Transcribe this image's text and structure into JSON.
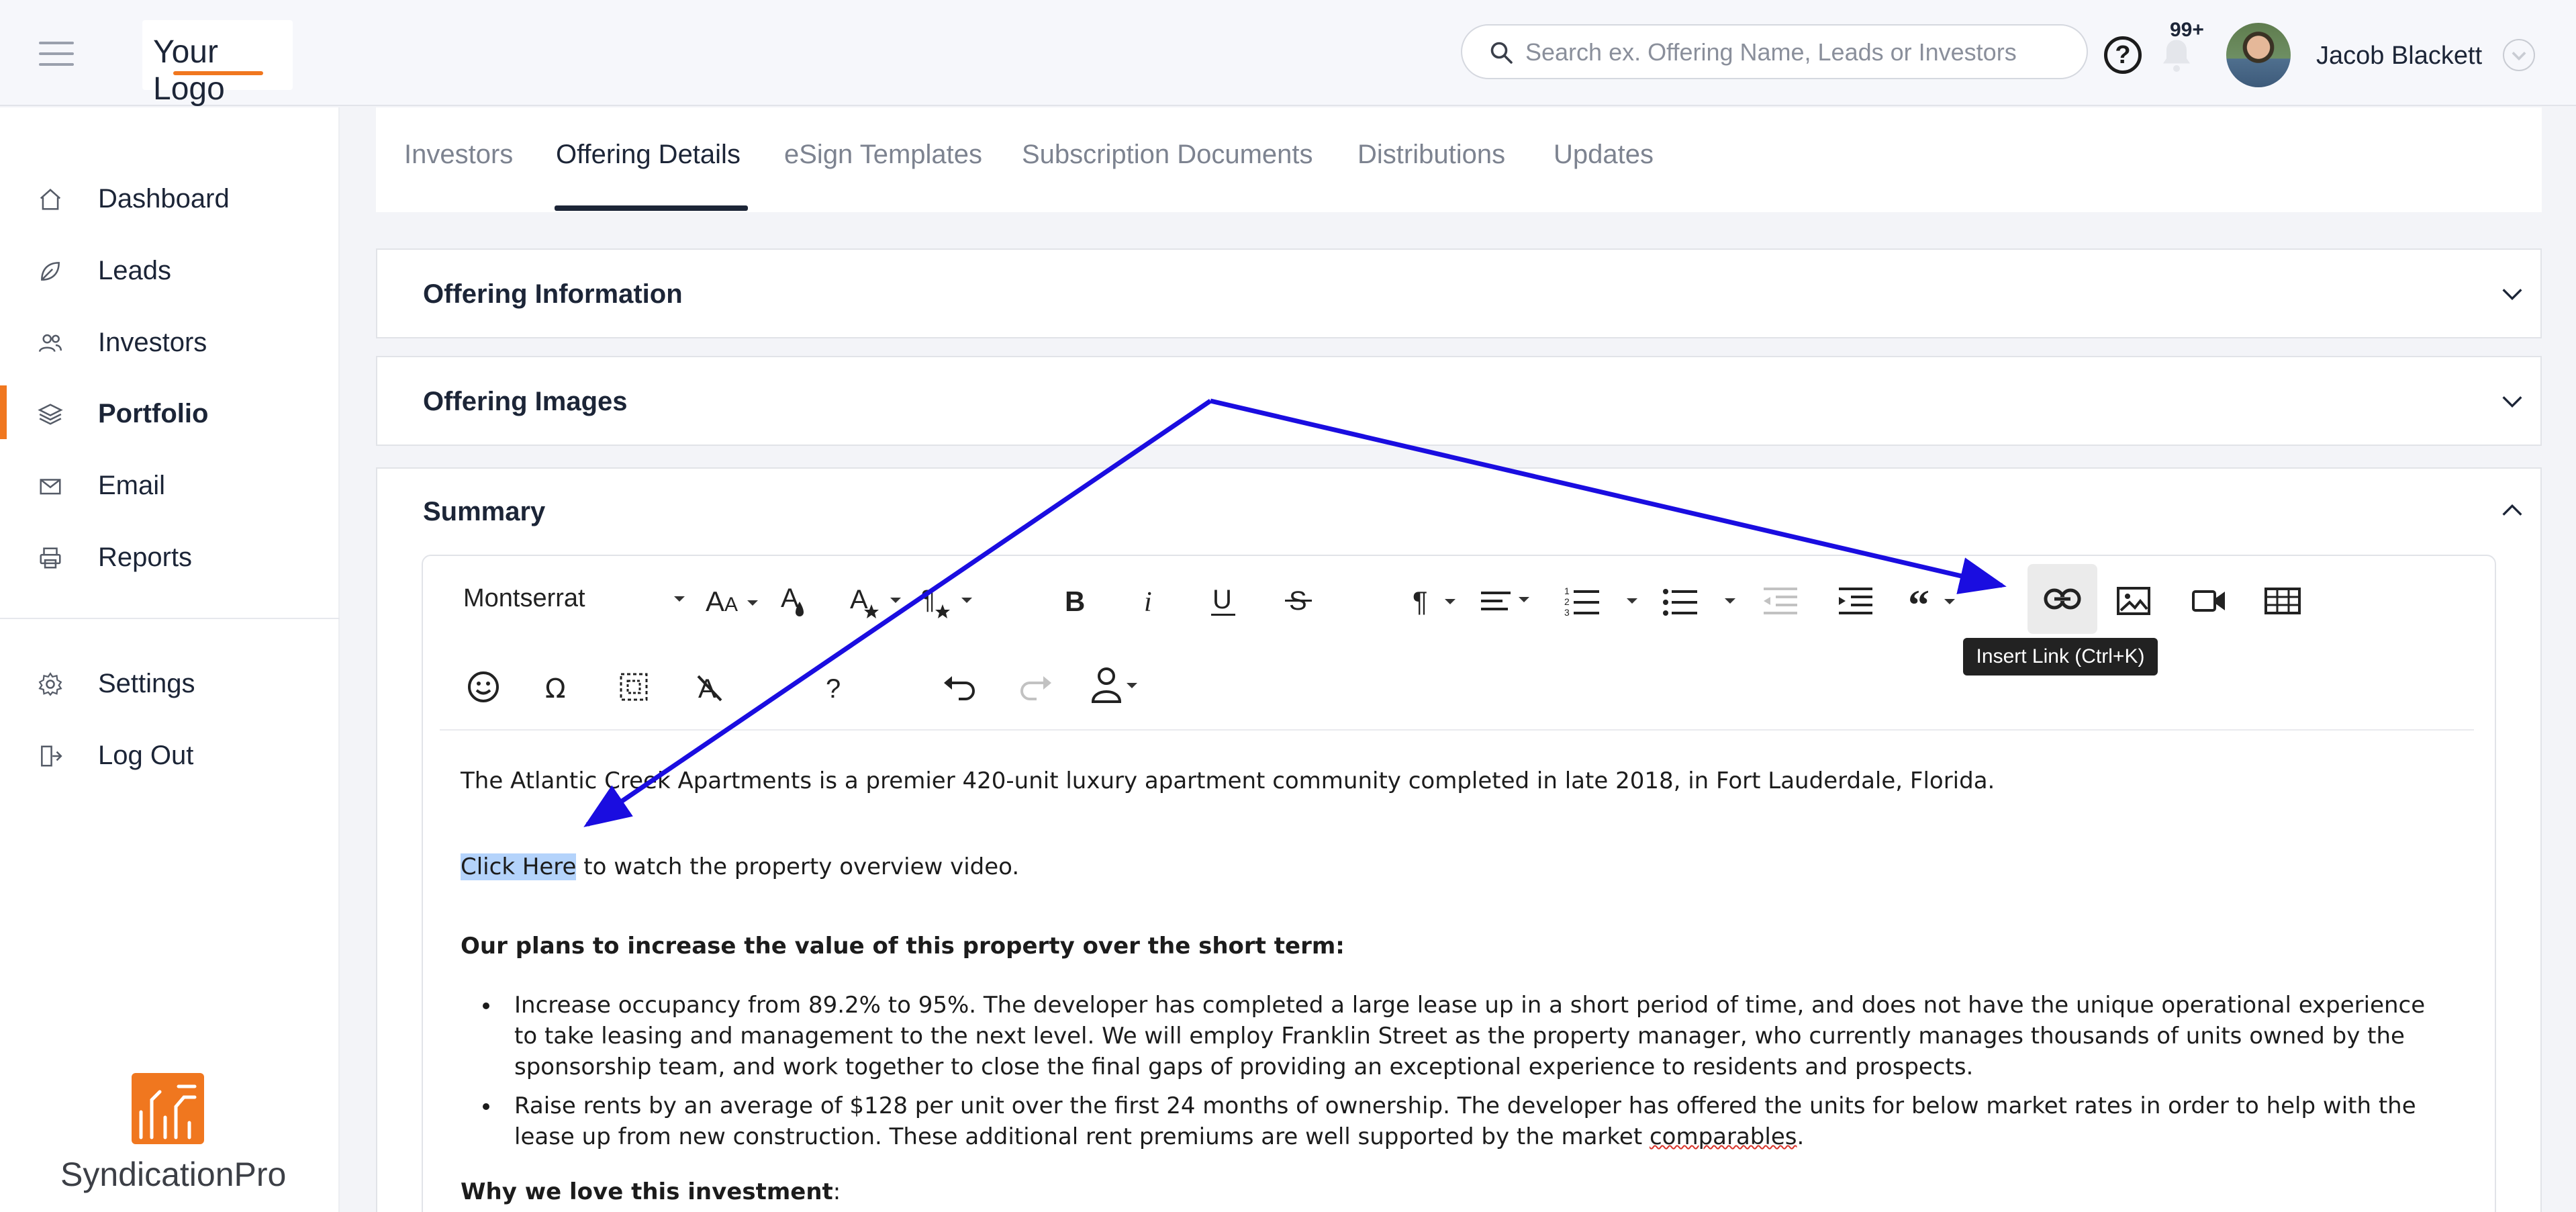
{
  "header": {
    "logo_text": "Your Logo",
    "search_placeholder": "Search ex. Offering Name, Leads or Investors",
    "help_label": "?",
    "notifications_badge": "99+",
    "user_name": "Jacob Blackett"
  },
  "sidebar": {
    "items": [
      {
        "label": "Dashboard",
        "icon": "home-icon"
      },
      {
        "label": "Leads",
        "icon": "leaf-icon"
      },
      {
        "label": "Investors",
        "icon": "users-icon"
      },
      {
        "label": "Portfolio",
        "icon": "layers-icon",
        "active": true
      },
      {
        "label": "Email",
        "icon": "mail-icon"
      },
      {
        "label": "Reports",
        "icon": "printer-icon"
      }
    ],
    "bottom_items": [
      {
        "label": "Settings",
        "icon": "gear-icon"
      },
      {
        "label": "Log Out",
        "icon": "logout-icon"
      }
    ],
    "brand": "SyndicationPro"
  },
  "tabs": [
    {
      "label": "Investors"
    },
    {
      "label": "Offering Details",
      "active": true
    },
    {
      "label": "eSign Templates"
    },
    {
      "label": "Subscription Documents"
    },
    {
      "label": "Distributions"
    },
    {
      "label": "Updates"
    }
  ],
  "panels": {
    "offering_information": "Offering Information",
    "offering_images": "Offering Images",
    "summary": "Summary"
  },
  "editor": {
    "font_family": "Montserrat",
    "tooltip": "Insert Link (Ctrl+K)",
    "para1": "The Atlantic Creek Apartments is a premier 420-unit luxury apartment community completed in late 2018, in Fort Lauderdale, Florida.",
    "link_text": "Click Here",
    "link_rest": " to watch the property overview video.",
    "heading1": "Our plans to increase the value of this property over the short term:",
    "bullet1": "Increase occupancy from 89.2% to 95%. The developer has completed a large lease up in a short period of time, and does not have the unique operational experience to take leasing and management to the next level. We will employ Franklin Street as the property manager, who currently manages thousands of units owned by the sponsorship team, and work together to close the final gaps of providing an exceptional experience to residents and prospects.",
    "bullet2_pre": "Raise rents by an average of $128 per unit over the first 24 months of ownership. The developer has offered the units for below market rates in order to help with the lease up from new construction. These additional rent premiums are well supported by the market ",
    "bullet2_misspelled": "comparables",
    "bullet2_post": ".",
    "heading2": "Why we love this investment",
    "heading2_colon": ":"
  },
  "colors": {
    "accent": "#f0771f",
    "annotation_arrow": "#1a0de0",
    "selection": "#b4d3fb"
  }
}
